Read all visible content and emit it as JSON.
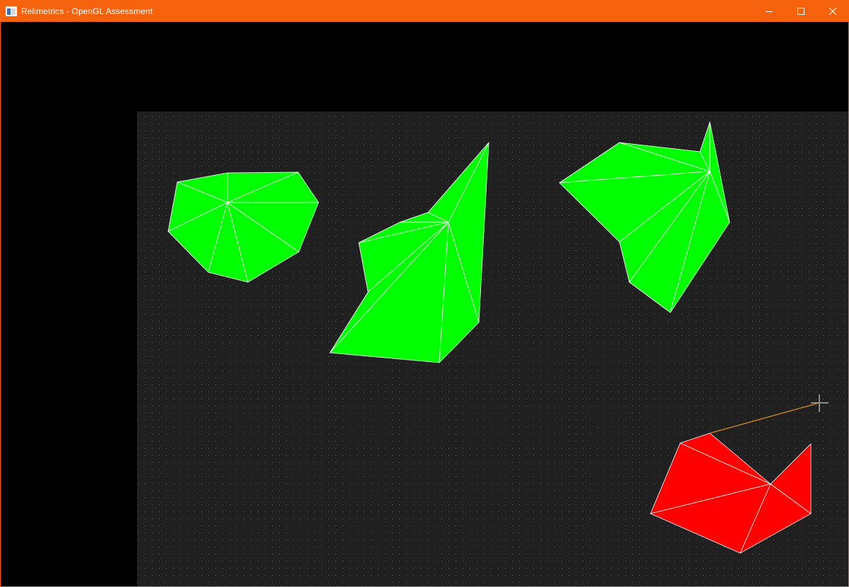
{
  "window": {
    "title": "Relimetrics - OpenGL Assessment",
    "app_icon": "window-app-icon",
    "controls": {
      "minimize_icon": "minimize-icon",
      "maximize_icon": "maximize-icon",
      "close_icon": "close-icon"
    },
    "accent_color": "#f7630c"
  },
  "canvas": {
    "background": "#000000",
    "grid_background": "#202020",
    "grid_dot_color": "#5a5a5a",
    "fill_colors": {
      "completed": "#00ff00",
      "active": "#ff0000"
    },
    "edge_color": "#ffffff",
    "rubber_band_color": "#d08a1a",
    "cursor_icon": "crosshair-cursor-icon",
    "polygons": [
      {
        "name": "polygon-1",
        "state": "completed",
        "vertex_count": 9
      },
      {
        "name": "polygon-2",
        "state": "completed",
        "vertex_count": 10
      },
      {
        "name": "polygon-3",
        "state": "completed",
        "vertex_count": 9
      },
      {
        "name": "polygon-4",
        "state": "active",
        "vertex_count": 6
      }
    ]
  }
}
